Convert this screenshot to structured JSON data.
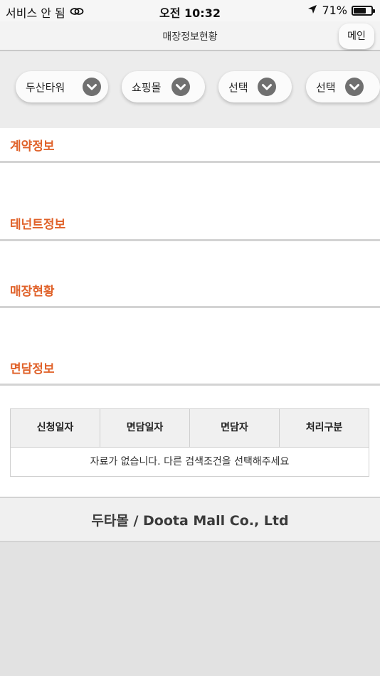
{
  "status_bar": {
    "carrier": "서비스 안 됨",
    "time": "오전 10:32",
    "battery_text": "71%",
    "battery_level": 0.71
  },
  "header": {
    "title": "매장정보현황",
    "main_button": "메인"
  },
  "filters": [
    {
      "label": "두산타워"
    },
    {
      "label": "쇼핑몰"
    },
    {
      "label": "선택"
    },
    {
      "label": "선택"
    }
  ],
  "sections": {
    "contract": "계약정보",
    "tenant": "테넌트정보",
    "store_status": "매장현황",
    "interview": "면담정보"
  },
  "interview_table": {
    "columns": [
      "신청일자",
      "면담일자",
      "면담자",
      "처리구분"
    ],
    "empty_message": "자료가 없습니다. 다른 검색조건을 선택해주세요"
  },
  "footer": {
    "text": "두타몰 / Doota Mall Co., Ltd"
  },
  "colors": {
    "section_accent": "#e0622a",
    "chevron_circle": "#707070"
  }
}
